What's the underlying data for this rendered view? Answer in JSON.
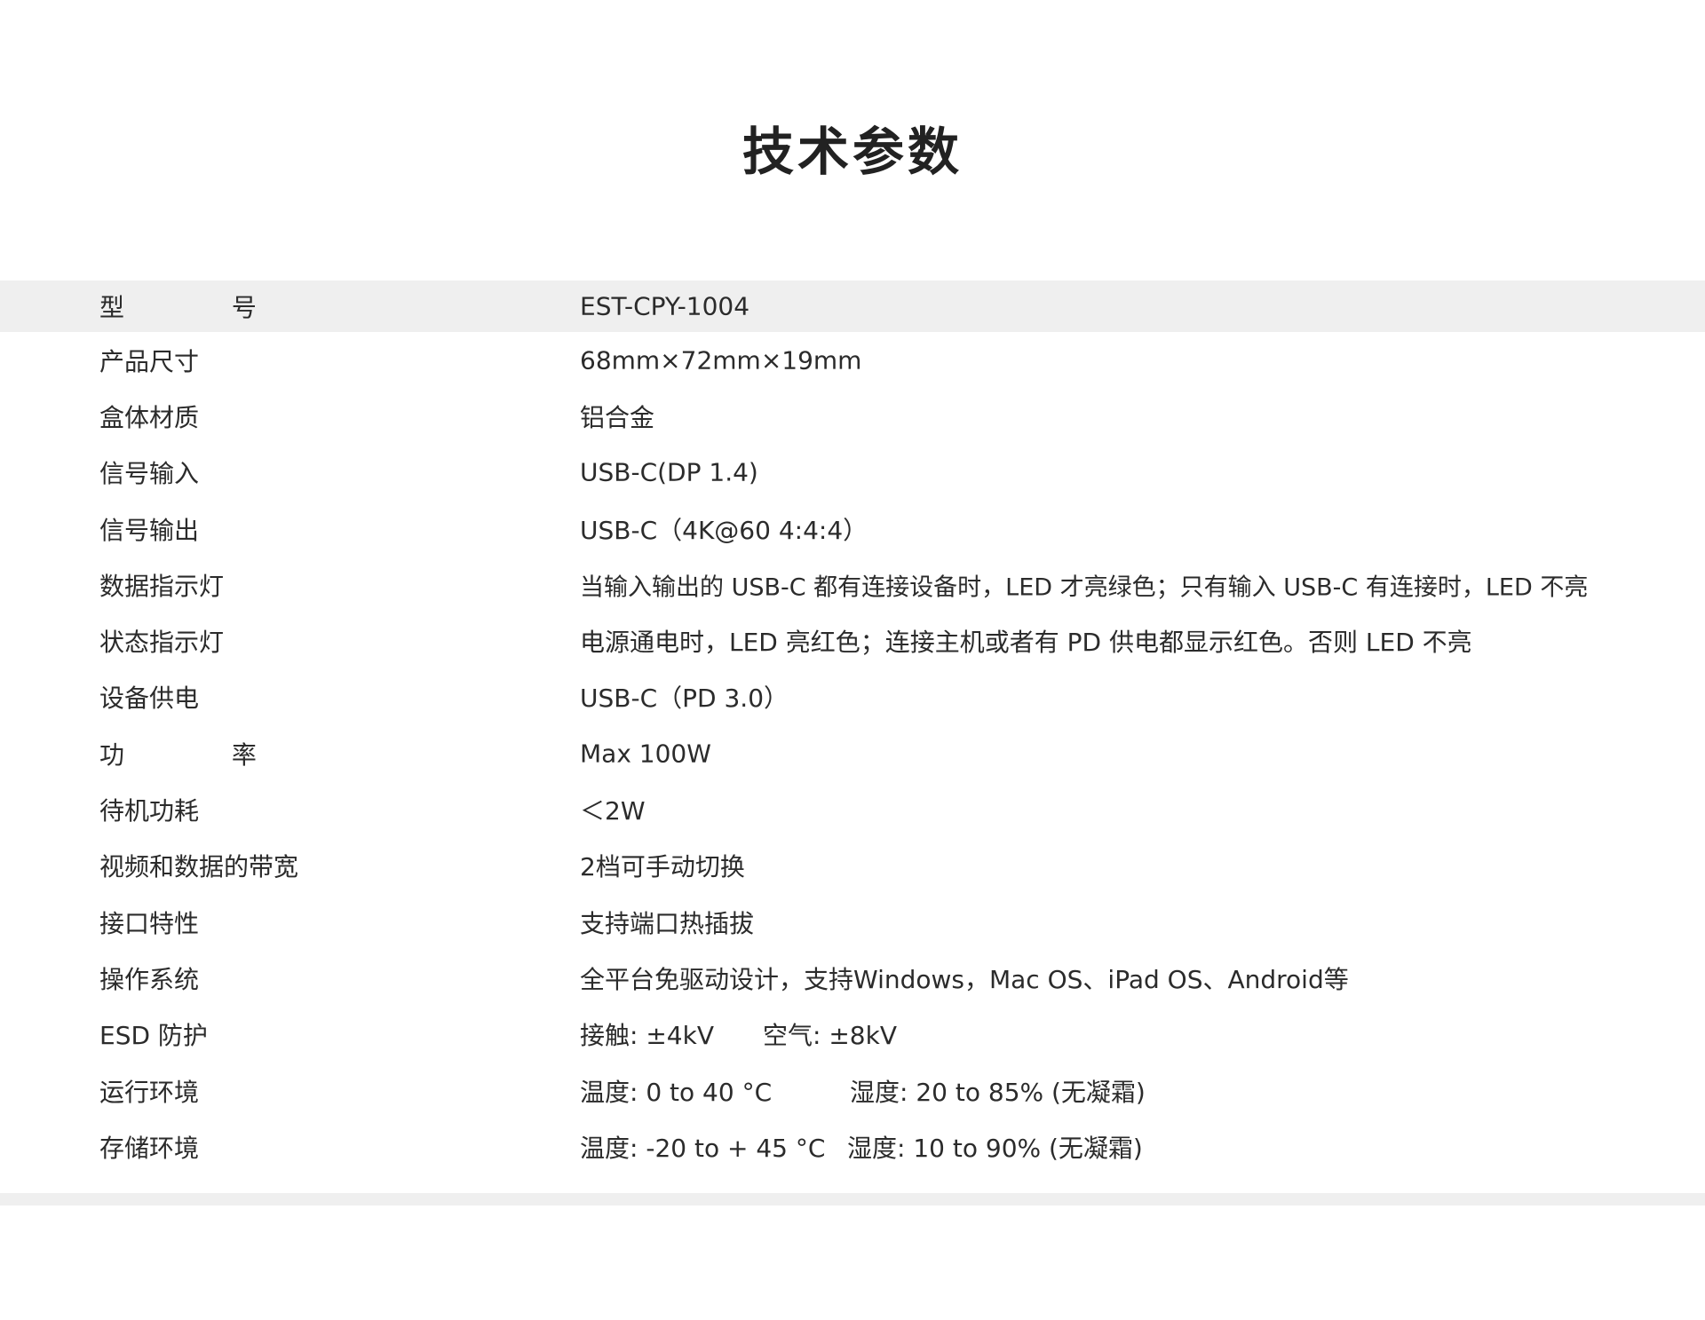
{
  "title": "技术参数",
  "specs": [
    {
      "label": "型 号",
      "value": "EST-CPY-1004"
    },
    {
      "label": "产品尺寸",
      "value": "68mm×72mm×19mm"
    },
    {
      "label": "盒体材质",
      "value": "铝合金"
    },
    {
      "label": "信号输入",
      "value": "USB-C(DP 1.4)"
    },
    {
      "label": "信号输出",
      "value": "USB-C（4K@60 4:4:4）"
    },
    {
      "label": "数据指示灯",
      "value": "当输入输出的 USB-C 都有连接设备时，LED 才亮绿色；只有输入 USB-C 有连接时，LED 不亮"
    },
    {
      "label": "状态指示灯",
      "value": "电源通电时，LED 亮红色；连接主机或者有 PD 供电都显示红色。否则 LED 不亮"
    },
    {
      "label": "设备供电",
      "value": "USB-C（PD 3.0）"
    },
    {
      "label": "功 率",
      "value": "Max 100W"
    },
    {
      "label": "待机功耗",
      "value": "＜2W"
    },
    {
      "label": "视频和数据的带宽",
      "value": "2档可手动切换"
    },
    {
      "label": "接口特性",
      "value": "支持端口热插拔"
    },
    {
      "label": "操作系统",
      "value": "全平台免驱动设计，支持Windows，Mac OS、iPad OS、Android等"
    },
    {
      "label": "ESD 防护",
      "value": "接触: ±4kV",
      "value2": "空气: ±8kV"
    },
    {
      "label": "运行环境",
      "value": "温度: 0 to 40 °C",
      "value2": "湿度: 20 to 85% (无凝霜)"
    },
    {
      "label": "存储环境",
      "value": "温度: -20 to + 45 °C",
      "value2": "湿度: 10 to 90% (无凝霜)"
    }
  ]
}
